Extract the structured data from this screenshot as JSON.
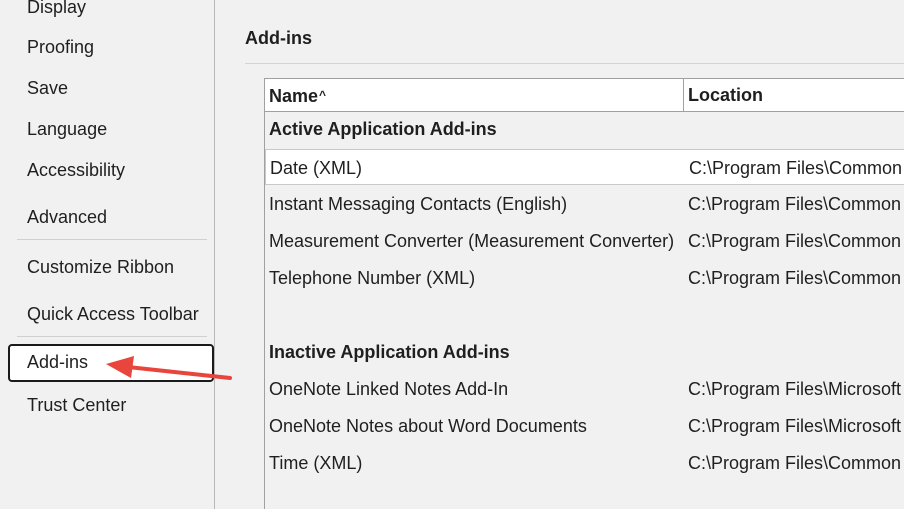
{
  "sidebar": {
    "items": [
      {
        "label": "Display"
      },
      {
        "label": "Proofing"
      },
      {
        "label": "Save"
      },
      {
        "label": "Language"
      },
      {
        "label": "Accessibility"
      },
      {
        "label": "Advanced"
      },
      {
        "label": "Customize Ribbon"
      },
      {
        "label": "Quick Access Toolbar"
      },
      {
        "label": "Add-ins",
        "selected": true
      },
      {
        "label": "Trust Center"
      }
    ]
  },
  "main": {
    "section_title": "Add-ins",
    "table": {
      "columns": [
        "Name",
        "Location"
      ],
      "sort_indicator": "^",
      "groups": [
        {
          "title": "Active Application Add-ins",
          "rows": [
            {
              "name": "Date (XML)",
              "location": "C:\\Program Files\\Common",
              "selected": true
            },
            {
              "name": "Instant Messaging Contacts (English)",
              "location": "C:\\Program Files\\Common"
            },
            {
              "name": "Measurement Converter (Measurement Converter)",
              "location": "C:\\Program Files\\Common"
            },
            {
              "name": "Telephone Number (XML)",
              "location": "C:\\Program Files\\Common"
            }
          ]
        },
        {
          "title": "Inactive Application Add-ins",
          "rows": [
            {
              "name": "OneNote Linked Notes Add-In",
              "location": "C:\\Program Files\\Microsoft"
            },
            {
              "name": "OneNote Notes about Word Documents",
              "location": "C:\\Program Files\\Microsoft"
            },
            {
              "name": "Time (XML)",
              "location": "C:\\Program Files\\Common"
            }
          ]
        }
      ]
    }
  },
  "annotation": {
    "arrow_color": "#e8453c"
  }
}
